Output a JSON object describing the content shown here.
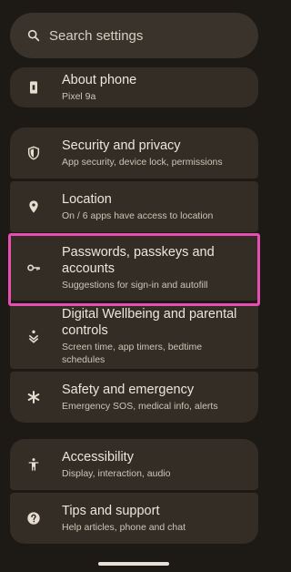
{
  "search": {
    "placeholder": "Search settings",
    "icon": "search-icon"
  },
  "groups": [
    {
      "items": [
        {
          "title": "About phone",
          "subtitle": "Pixel 9a",
          "icon": "phone-icon"
        }
      ]
    },
    {
      "items": [
        {
          "title": "Security and privacy",
          "subtitle": "App security, device lock, permissions",
          "icon": "shield-icon"
        },
        {
          "title": "Location",
          "subtitle": "On / 6 apps have access to location",
          "icon": "location-pin-icon"
        },
        {
          "title": "Passwords, passkeys and accounts",
          "subtitle": "Suggestions for sign-in and autofill",
          "icon": "key-icon",
          "highlighted": true
        },
        {
          "title": "Digital Wellbeing and parental controls",
          "subtitle": "Screen time, app timers, bedtime schedules",
          "icon": "wellbeing-icon"
        },
        {
          "title": "Safety and emergency",
          "subtitle": "Emergency SOS, medical info, alerts",
          "icon": "asterisk-icon"
        }
      ]
    },
    {
      "items": [
        {
          "title": "Accessibility",
          "subtitle": "Display, interaction, audio",
          "icon": "accessibility-icon"
        },
        {
          "title": "Tips and support",
          "subtitle": "Help articles, phone and chat",
          "icon": "help-icon"
        }
      ]
    }
  ],
  "colors": {
    "highlight": "#e84db1",
    "background": "#1d1a16",
    "card": "#342d26"
  }
}
